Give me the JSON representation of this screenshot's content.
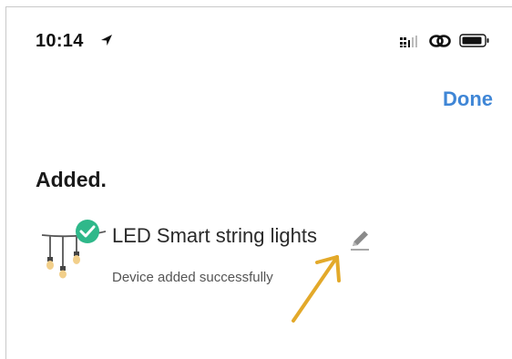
{
  "status_bar": {
    "time": "10:14",
    "location_icon": "location-arrow-icon",
    "signal_icon": "cellular-signal-icon",
    "link_icon": "link-icon",
    "battery_icon": "battery-icon"
  },
  "header": {
    "done_label": "Done"
  },
  "section": {
    "heading": "Added."
  },
  "device": {
    "name": "LED Smart string lights",
    "status": "Device added successfully",
    "image_icon": "string-lights-icon",
    "badge_icon": "check-badge-icon",
    "edit_icon": "pencil-icon"
  },
  "colors": {
    "accent": "#3f86d6",
    "success": "#2fb88a",
    "annotation": "#e3a92a"
  }
}
